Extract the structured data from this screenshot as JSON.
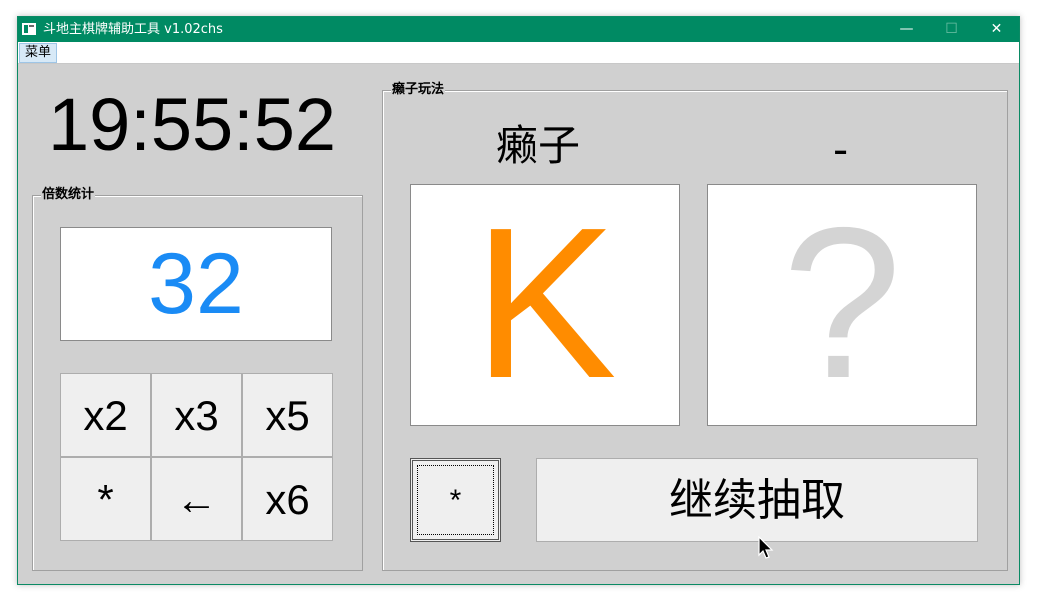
{
  "window": {
    "title": "斗地主棋牌辅助工具 v1.02chs"
  },
  "titlebar": {
    "minimize": "—",
    "maximize": "☐",
    "close": "✕"
  },
  "menu": {
    "items": [
      "菜单"
    ]
  },
  "clock": {
    "time": "19:55:52"
  },
  "multiplier_group": {
    "label": "倍数统计",
    "value": "32",
    "value_color": "#1a8bf5",
    "buttons": [
      "x2",
      "x3",
      "x5",
      "*",
      "←",
      "x6"
    ]
  },
  "laizi_group": {
    "label": "癞子玩法",
    "left_title": "癞子",
    "right_title": "-",
    "left_card": "K",
    "left_card_color": "#ff8c00",
    "right_card": "?",
    "right_card_color": "#d4d4d4",
    "star_button": "*",
    "draw_button": "继续抽取"
  }
}
